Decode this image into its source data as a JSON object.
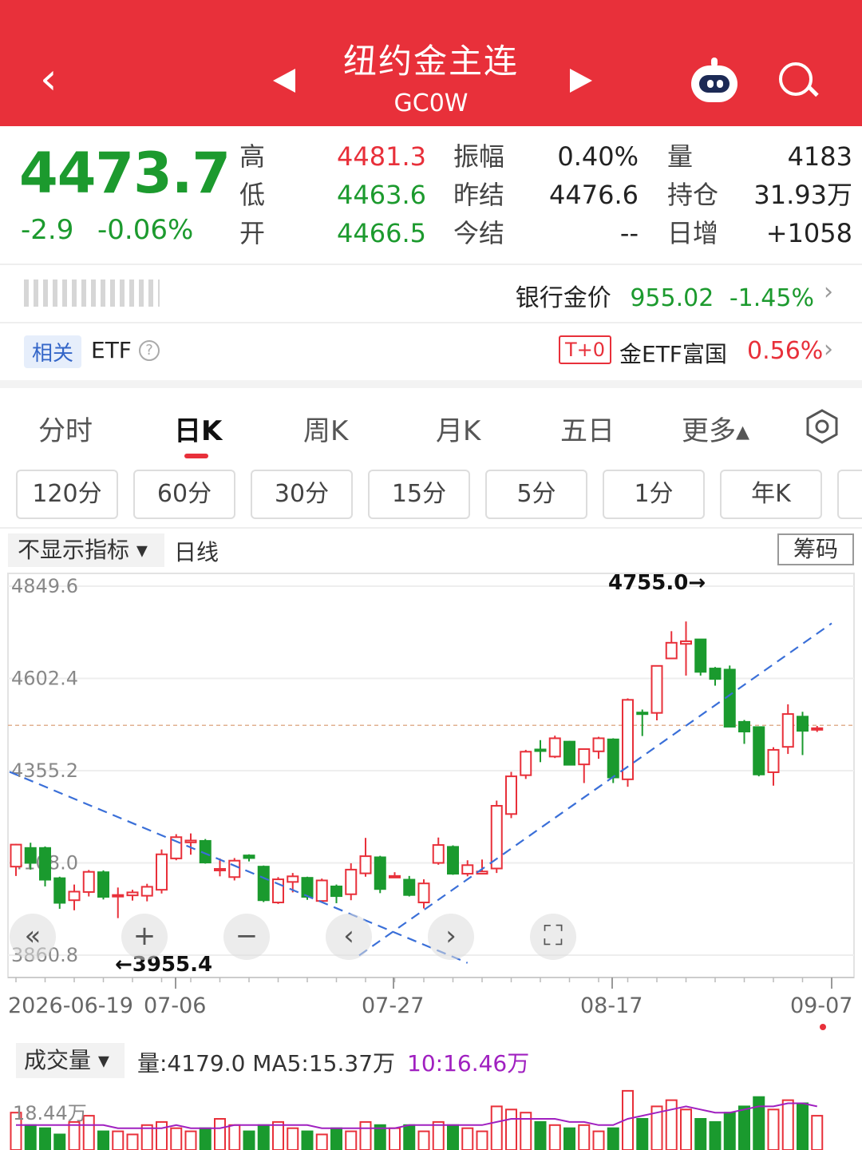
{
  "header": {
    "back_icon": "‹",
    "title": "纽约金主连",
    "code": "GC0W"
  },
  "quote": {
    "price": "4473.7",
    "change": "-2.9",
    "change_pct": "-0.06%",
    "high_label": "高",
    "high": "4481.3",
    "low_label": "低",
    "low": "4463.6",
    "open_label": "开",
    "open": "4466.5",
    "amp_label": "振幅",
    "amp": "0.40%",
    "prev_label": "昨结",
    "prev": "4476.6",
    "today_label": "今结",
    "today": "--",
    "vol_label": "量",
    "vol": "4183",
    "oi_label": "持仓",
    "oi": "31.93万",
    "inc_label": "日增",
    "inc": "+1058"
  },
  "bank": {
    "label": "银行金价",
    "price": "955.02",
    "pct": "-1.45%"
  },
  "etf": {
    "tag": "相关",
    "label": "ETF",
    "q": "?",
    "t0": "T+0",
    "name": "金ETF富国",
    "pct": "0.56%"
  },
  "tabs": [
    "分时",
    "日K",
    "周K",
    "月K",
    "五日",
    "更多▴"
  ],
  "periods": [
    "120分",
    "60分",
    "30分",
    "15分",
    "5分",
    "1分",
    "年K"
  ],
  "controls": {
    "indicator": "不显示指标 ▾",
    "line": "日线",
    "chip": "筹码"
  },
  "chart_data": {
    "type": "candlestick",
    "y_ticks": [
      "4849.6",
      "4602.4",
      "4355.2",
      "4108.0",
      "3860.8"
    ],
    "x_ticks": [
      "2026-06-19",
      "07-06",
      "07-27",
      "08-17",
      "09-07"
    ],
    "max_label": "4755.0→",
    "min_label": "←3955.4",
    "reference_price": 4476.6,
    "candles": [
      [
        4098,
        4157,
        4073,
        4159
      ],
      [
        4148,
        4108,
        4090,
        4162
      ],
      [
        4148,
        4063,
        4045,
        4152
      ],
      [
        4067,
        4001,
        3985,
        4071
      ],
      [
        4008,
        4031,
        3981,
        4050
      ],
      [
        4030,
        4084,
        4018,
        4089
      ],
      [
        4083,
        4017,
        4010,
        4088
      ],
      [
        4020,
        4022,
        3960,
        4042
      ],
      [
        4021,
        4029,
        4007,
        4036
      ],
      [
        4020,
        4044,
        4005,
        4052
      ],
      [
        4036,
        4131,
        4026,
        4144
      ],
      [
        4120,
        4177,
        4115,
        4185
      ],
      [
        4163,
        4168,
        4130,
        4187
      ],
      [
        4167,
        4109,
        4106,
        4172
      ],
      [
        4092,
        4092,
        4072,
        4120
      ],
      [
        4070,
        4114,
        4061,
        4121
      ],
      [
        4128,
        4121,
        4112,
        4131
      ],
      [
        4098,
        4008,
        4003,
        4101
      ],
      [
        4002,
        4064,
        3998,
        4070
      ],
      [
        4057,
        4072,
        4029,
        4081
      ],
      [
        4068,
        4017,
        4009,
        4071
      ],
      [
        4006,
        4061,
        4006,
        4066
      ],
      [
        4045,
        4019,
        4000,
        4050
      ],
      [
        4024,
        4090,
        4008,
        4107
      ],
      [
        4080,
        4126,
        4071,
        4175
      ],
      [
        4123,
        4038,
        4027,
        4127
      ],
      [
        4073,
        4073,
        4068,
        4083
      ],
      [
        4063,
        4022,
        4018,
        4073
      ],
      [
        4002,
        4053,
        3986,
        4064
      ],
      [
        4108,
        4156,
        4103,
        4176
      ],
      [
        4151,
        4079,
        4076,
        4155
      ],
      [
        4079,
        4102,
        4072,
        4115
      ],
      [
        4079,
        4085,
        4077,
        4117
      ],
      [
        4093,
        4261,
        4081,
        4275
      ],
      [
        4239,
        4340,
        4228,
        4352
      ],
      [
        4343,
        4406,
        4333,
        4411
      ],
      [
        4412,
        4409,
        4378,
        4437
      ],
      [
        4393,
        4442,
        4389,
        4449
      ],
      [
        4433,
        4371,
        4370,
        4435
      ],
      [
        4372,
        4413,
        4322,
        4413
      ],
      [
        4407,
        4442,
        4387,
        4446
      ],
      [
        4439,
        4337,
        4322,
        4442
      ],
      [
        4332,
        4545,
        4312,
        4549
      ],
      [
        4511,
        4509,
        4448,
        4519
      ],
      [
        4510,
        4636,
        4490,
        4637
      ],
      [
        4656,
        4698,
        4655,
        4729
      ],
      [
        4695,
        4702,
        4610,
        4755
      ],
      [
        4707,
        4620,
        4610,
        4707
      ],
      [
        4629,
        4601,
        4583,
        4633
      ],
      [
        4626,
        4473,
        4472,
        4637
      ],
      [
        4486,
        4460,
        4427,
        4491
      ],
      [
        4472,
        4345,
        4340,
        4474
      ],
      [
        4351,
        4411,
        4315,
        4418
      ],
      [
        4419,
        4507,
        4400,
        4533
      ],
      [
        4500,
        4462,
        4397,
        4513
      ],
      [
        4466,
        4469,
        4459,
        4475
      ]
    ],
    "trend_line_1": {
      "from": [
        "06-19",
        4352
      ],
      "to": [
        "07-30",
        3840
      ]
    },
    "trend_line_2": {
      "from": [
        "07-21",
        3860
      ],
      "to": [
        "09-08",
        4750
      ]
    }
  },
  "volume": {
    "selector": "成交量 ▾",
    "info": "量:4179.0  MA5:15.37万",
    "ma10": "10:16.46万",
    "axis_label": "18.44万",
    "values": [
      12,
      8,
      7,
      5,
      9,
      11,
      6,
      6,
      5,
      8,
      9,
      7,
      6,
      7,
      10,
      8,
      6,
      8,
      9,
      7,
      6,
      5,
      7,
      6,
      9,
      8,
      7,
      8,
      6,
      9,
      8,
      7,
      6,
      14,
      13,
      12,
      9,
      8,
      7,
      8,
      6,
      7,
      19,
      10,
      14,
      16,
      13,
      10,
      9,
      12,
      14,
      17,
      13,
      16,
      15,
      11
    ],
    "ma5": [
      8,
      8,
      8,
      8,
      8,
      8,
      8,
      7,
      7,
      7,
      7,
      8,
      7,
      7,
      7,
      8,
      8,
      8,
      8,
      8,
      8,
      7,
      7,
      7,
      7,
      7,
      7,
      8,
      8,
      8,
      8,
      8,
      8,
      9,
      10,
      10,
      10,
      10,
      9,
      9,
      8,
      8,
      10,
      11,
      12,
      13,
      14,
      13,
      12,
      12,
      13,
      14,
      14,
      15,
      15,
      14
    ]
  }
}
